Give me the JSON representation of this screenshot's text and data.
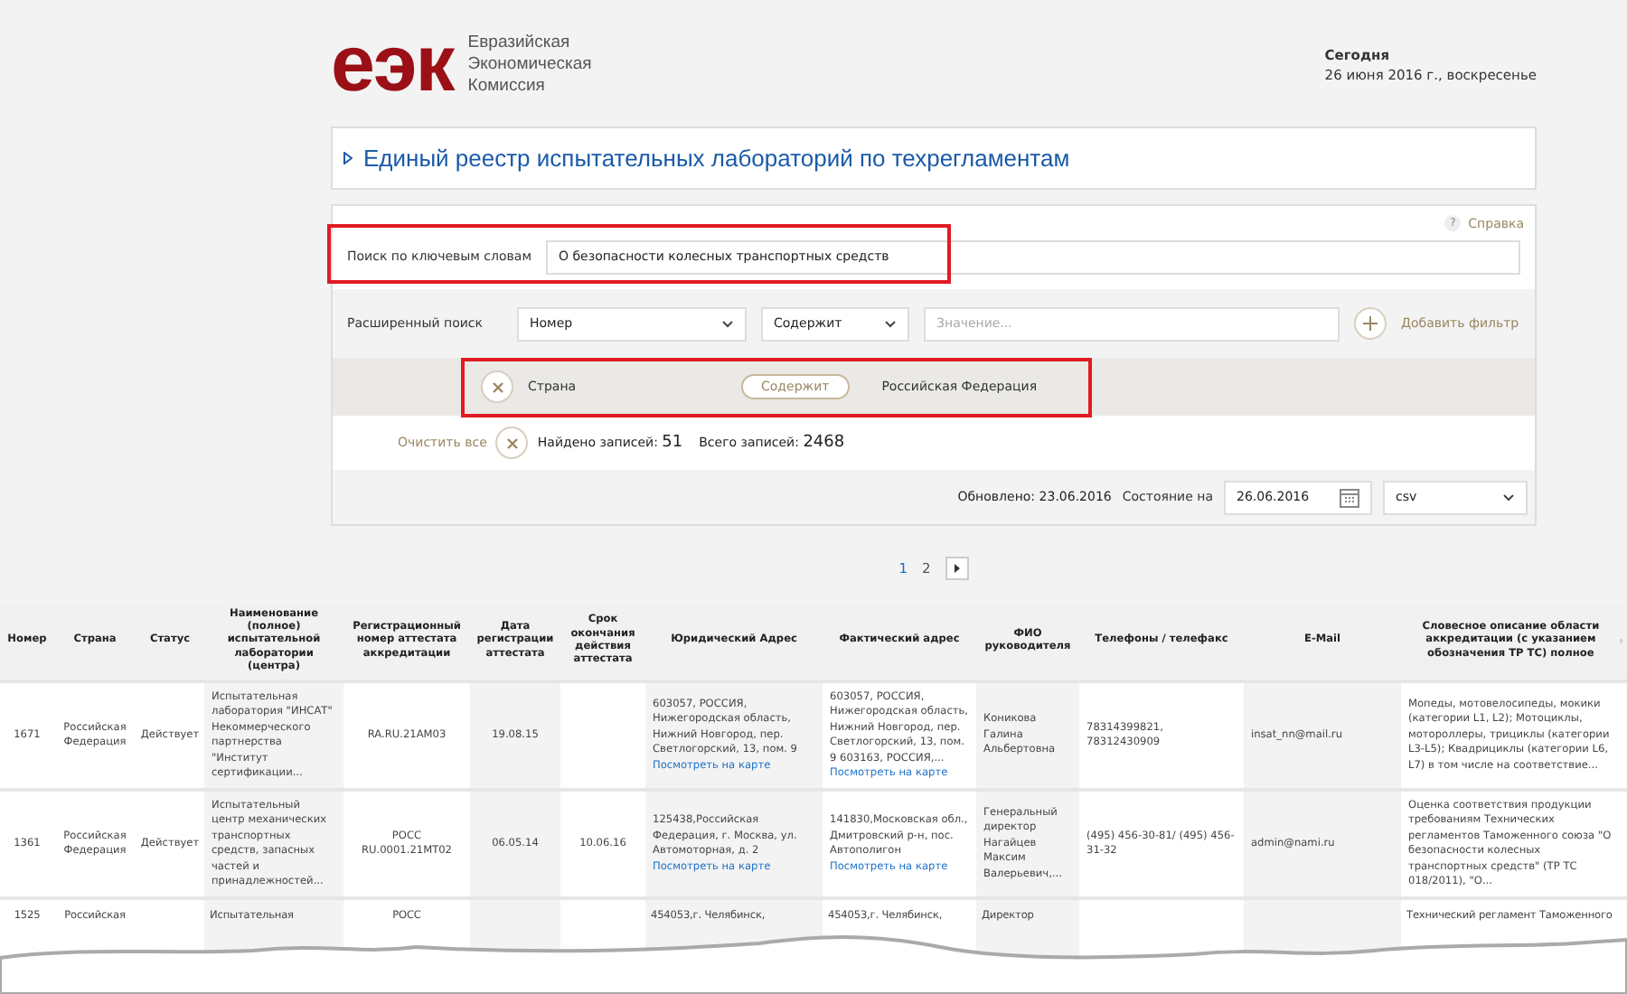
{
  "header": {
    "logo_mark": "еэк",
    "logo_lines": [
      "Евразийская",
      "Экономическая",
      "Комиссия"
    ],
    "today_label": "Сегодня",
    "today_date": "26 июня 2016 г., воскресенье"
  },
  "title": "Единый реестр испытательных лабораторий по техрегламентам",
  "search": {
    "help_icon": "?",
    "help": "Справка",
    "keyword": {
      "label": "Поиск по ключевым словам",
      "value": "О безопасности колесных транспортных средств"
    },
    "advanced": {
      "label": "Расширенный поиск",
      "field": "Номер",
      "condition": "Содержит",
      "placeholder": "Значение...",
      "add_button": "Добавить фильтр"
    },
    "filters": [
      {
        "field": "Страна",
        "condition": "Содержит",
        "value": "Российская Федерация"
      }
    ],
    "clear_all": "Очистить все",
    "found_label": "Найдено записей:",
    "found_count": "51",
    "total_label": "Всего записей:",
    "total_count": "2468",
    "updated_label": "Обновлено:",
    "updated_date": "23.06.2016",
    "state_label": "Состояние на",
    "state_date": "26.06.2016",
    "format": "csv"
  },
  "pagination": [
    {
      "label": "1",
      "selected": true
    },
    {
      "label": "2",
      "selected": false
    }
  ],
  "table": {
    "columns": [
      "Номер",
      "Страна",
      "Статус",
      "Наименование (полное) испытательной лаборатории (центра)",
      "Регистрационный номер аттестата аккредитации",
      "Дата регистрации аттестата",
      "Срок окончания действия аттестата",
      "Юридический Адрес",
      "Фактический адрес",
      "ФИО руководителя",
      "Телефоны / телефакс",
      "E-Mail",
      "Словесное описание области аккредитации (с указанием обозначения ТР ТС) полное"
    ],
    "rows": [
      {
        "cells": [
          {
            "text": "1671"
          },
          {
            "text": "Российская Федерация"
          },
          {
            "text": "Действует"
          },
          {
            "text": "Испытательная лаборатория \"ИНСАТ\" Некоммерческого партнерства \"Институт сертификации..."
          },
          {
            "text": "RA.RU.21АМ03"
          },
          {
            "text": "19.08.15"
          },
          {
            "text": ""
          },
          {
            "text": "603057, РОССИЯ, Нижегородская область, Нижний Новгород, пер. Светлогорский, 13, пом. 9",
            "link": "Посмотреть на карте"
          },
          {
            "text": "603057, РОССИЯ, Нижегородская область, Нижний Новгород, пер. Светлогорский, 13, пом. 9 603163, РОССИЯ,...",
            "link": "Посмотреть на карте"
          },
          {
            "text": "Коникова Галина Альбертовна"
          },
          {
            "text": "78314399821, 78312430909"
          },
          {
            "text": "insat_nn@mail.ru"
          },
          {
            "text": "Мопеды, мотовелосипеды, мокики (категории L1, L2); Мотоциклы, мотороллеры, трициклы (категории L3-L5); Квадрициклы (категории L6, L7) в том числе на соответствие..."
          }
        ]
      },
      {
        "cells": [
          {
            "text": "1361"
          },
          {
            "text": "Российская Федерация"
          },
          {
            "text": "Действует"
          },
          {
            "text": "Испытательный центр механических транспортных средств, запасных частей и принадлежностей..."
          },
          {
            "text": "РОСС RU.0001.21МТ02"
          },
          {
            "text": "06.05.14"
          },
          {
            "text": "10.06.16"
          },
          {
            "text": "125438,Российская Федерация, г. Москва, ул. Автомоторная, д. 2",
            "link": "Посмотреть на карте"
          },
          {
            "text": "141830,Московская обл., Дмитровский р-н, пос. Автополигон",
            "link": "Посмотреть на карте"
          },
          {
            "text": "Генеральный директор Нагайцев Максим Валерьевич,..."
          },
          {
            "text": "(495) 456-30-81/ (495) 456-31-32"
          },
          {
            "text": "admin@nami.ru"
          },
          {
            "text": "Оценка соответствия продукции требованиям Технических регламентов Таможенного союза \"О безопасности колесных транспортных средств\" (ТР ТС 018/2011), \"О..."
          }
        ]
      },
      {
        "cells": [
          {
            "text": "1525"
          },
          {
            "text": "Российская"
          },
          {
            "text": ""
          },
          {
            "text": "Испытательная"
          },
          {
            "text": "РОСС"
          },
          {
            "text": ""
          },
          {
            "text": ""
          },
          {
            "text": "454053,г. Челябинск,"
          },
          {
            "text": "454053,г. Челябинск,"
          },
          {
            "text": "Директор"
          },
          {
            "text": ""
          },
          {
            "text": ""
          },
          {
            "text": "Технический регламент Таможенного"
          }
        ]
      }
    ]
  }
}
